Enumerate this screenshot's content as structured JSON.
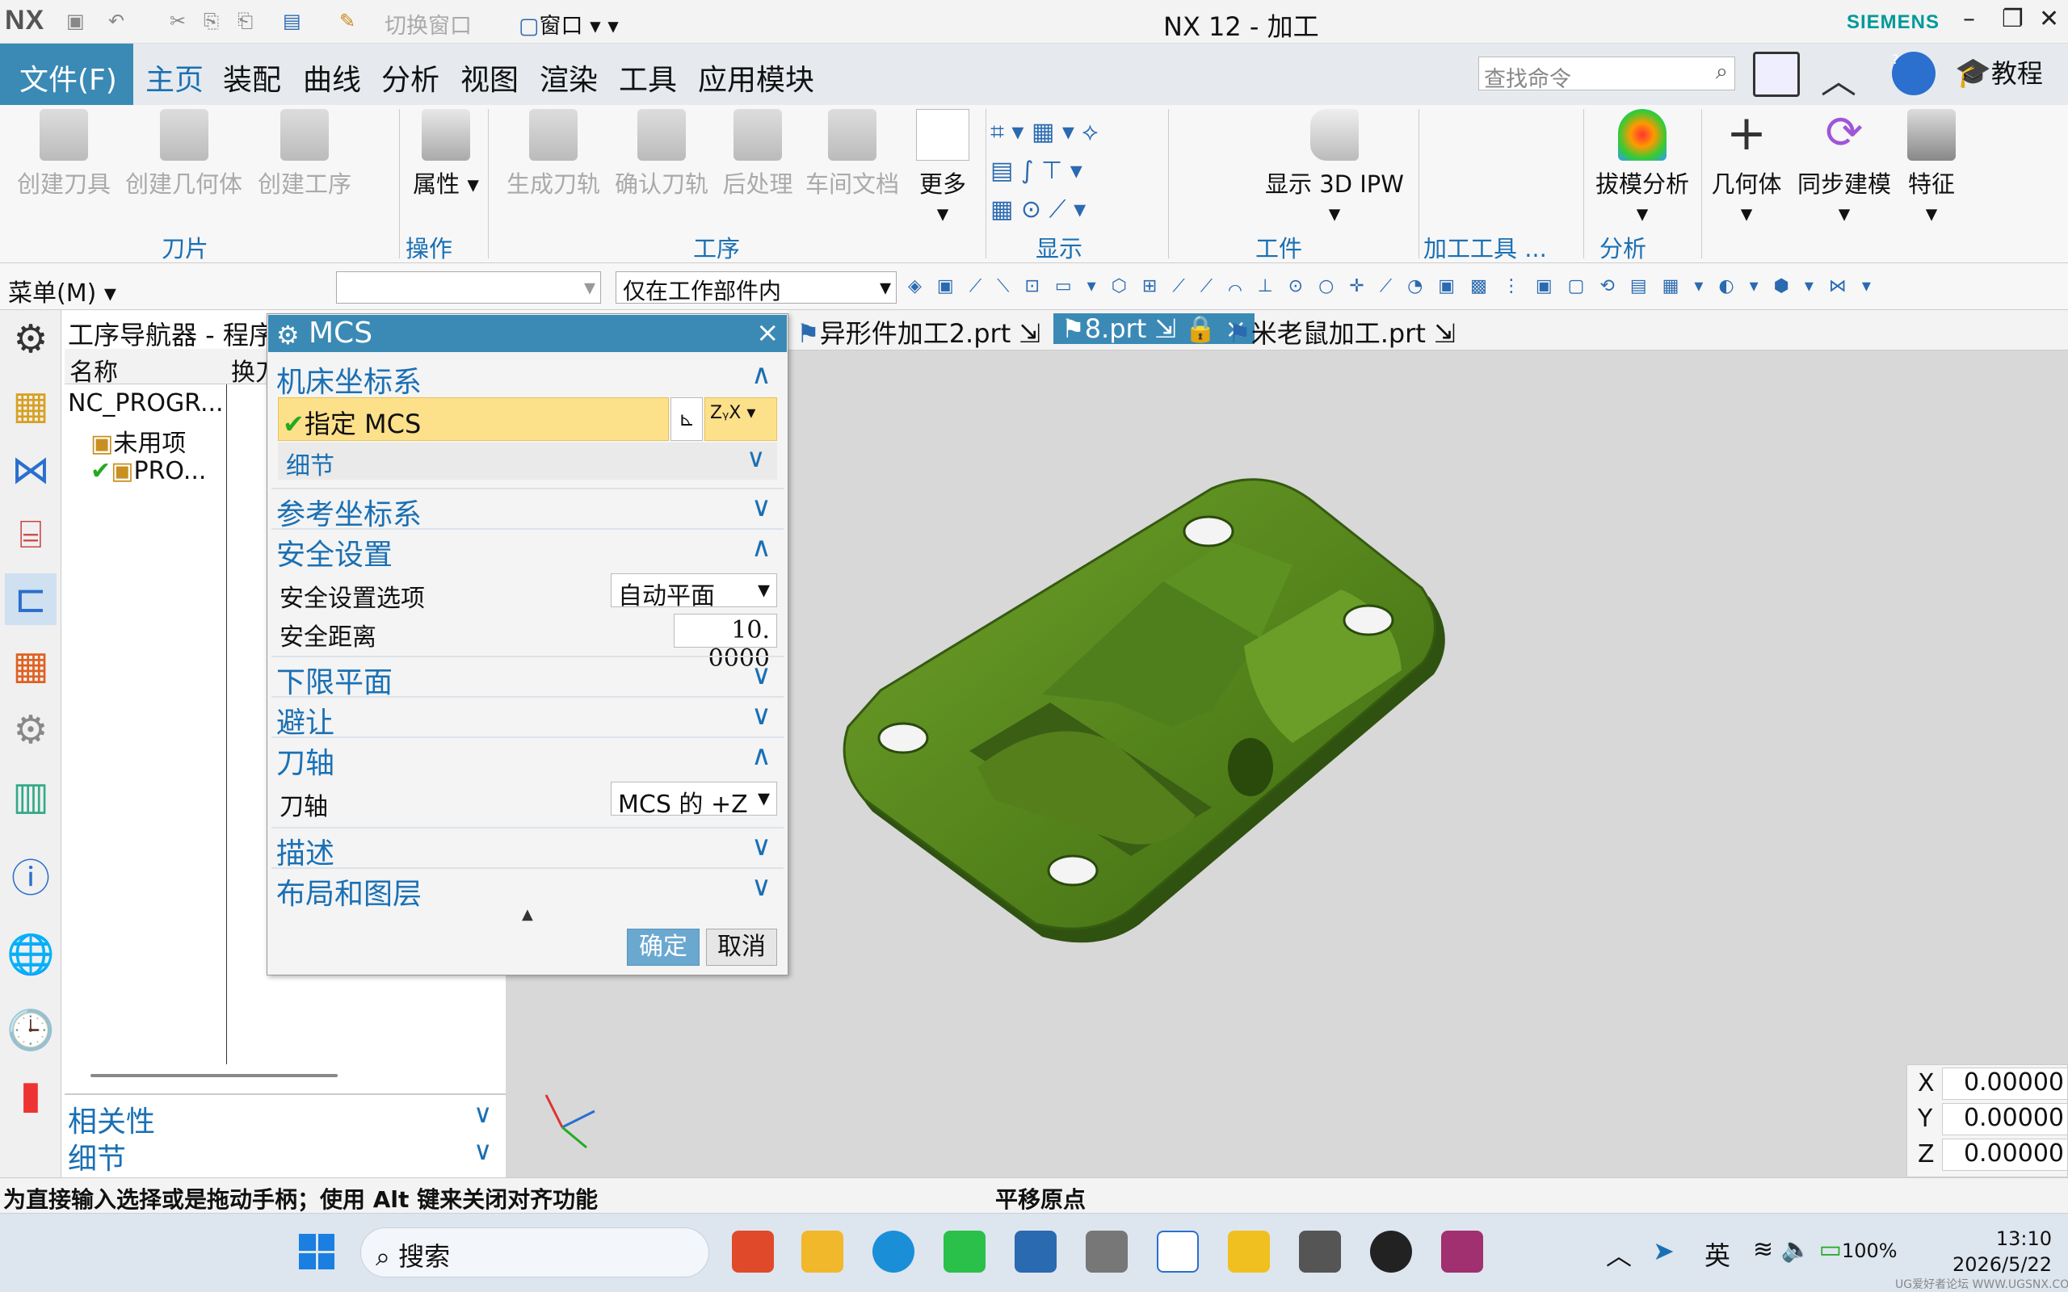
{
  "app": {
    "logo": "NX",
    "title": "NX 12 - 加工",
    "brand": "SIEMENS"
  },
  "quick_access": {
    "switch_window": "切换窗口",
    "window": "窗口"
  },
  "menu": {
    "file": "文件(F)",
    "tabs": [
      "主页",
      "装配",
      "曲线",
      "分析",
      "视图",
      "渲染",
      "工具",
      "应用模块"
    ],
    "search_placeholder": "查找命令",
    "tutorial": "教程"
  },
  "ribbon": {
    "buttons": [
      "创建刀具",
      "创建几何体",
      "创建工序",
      "属性",
      "生成刀轨",
      "确认刀轨",
      "后处理",
      "车间文档",
      "更多",
      "显示 3D IPW",
      "拔模分析",
      "几何体",
      "同步建模",
      "特征"
    ],
    "groups": [
      "刀片",
      "操作",
      "工序",
      "显示",
      "工件",
      "加工工具 ...",
      "分析"
    ]
  },
  "toolbar2": {
    "menu": "菜单(M)",
    "scope": "仅在工作部件内"
  },
  "navigator": {
    "title": "工序导航器 - 程序顺",
    "columns": [
      "名称",
      "换刀"
    ],
    "rows": [
      "NC_PROGR...",
      "未用项",
      "PRO..."
    ],
    "sections": [
      "相关性",
      "细节"
    ]
  },
  "file_tabs": [
    "异形件加工2.prt",
    "8.prt",
    "米老鼠加工.prt"
  ],
  "dialog": {
    "title": "MCS",
    "machine_cs": "机床坐标系",
    "specify_mcs": "指定 MCS",
    "details": "细节",
    "ref_cs": "参考坐标系",
    "safety": "安全设置",
    "safety_option_label": "安全设置选项",
    "safety_option_value": "自动平面",
    "safety_distance_label": "安全距离",
    "safety_distance_value": "10. 0000",
    "lower_plane": "下限平面",
    "avoidance": "避让",
    "tool_axis_section": "刀轴",
    "tool_axis_label": "刀轴",
    "tool_axis_value": "MCS 的 +Z",
    "description": "描述",
    "layout_layers": "布局和图层",
    "ok": "确定",
    "cancel": "取消"
  },
  "coords": {
    "x_label": "X",
    "y_label": "Y",
    "z_label": "Z",
    "x": "0.00000",
    "y": "0.00000",
    "z": "0.00000"
  },
  "status": {
    "left": "为直接输入选择或是拖动手柄；使用 Alt 键来关闭对齐功能",
    "center": "平移原点"
  },
  "taskbar": {
    "search": "搜索",
    "lang": "英",
    "battery": "100%",
    "time": "13:10",
    "date": "2026/5/22",
    "watermark": "UG爱好者论坛 WWW.UGSNX.COM"
  },
  "colors": {
    "accent": "#3a8ab5",
    "link": "#1a70b4",
    "model": "#5a8a1e",
    "highlight": "#fde08a"
  }
}
